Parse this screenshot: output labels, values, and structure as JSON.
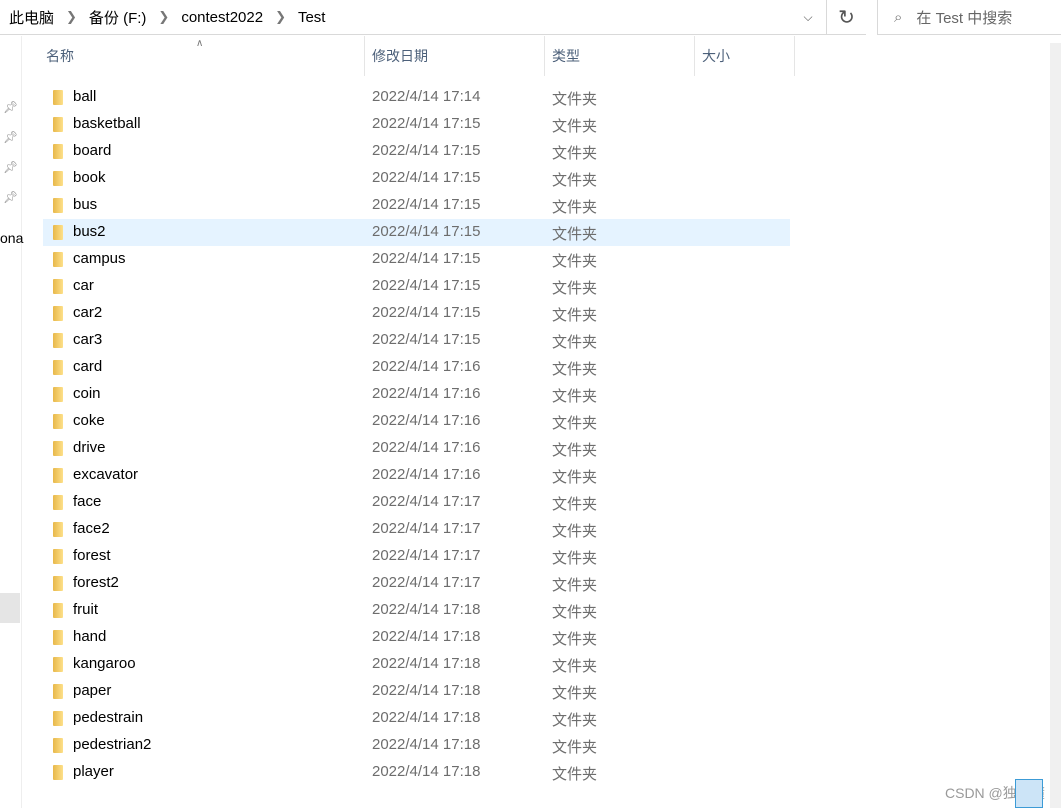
{
  "breadcrumb": [
    "此电脑",
    "备份 (F:)",
    "contest2022",
    "Test"
  ],
  "search": {
    "placeholder": "在 Test 中搜索"
  },
  "nav": {
    "partial_label": "ona"
  },
  "columns": {
    "name": "名称",
    "date": "修改日期",
    "type": "类型",
    "size": "大小"
  },
  "files": [
    {
      "name": "ball",
      "date": "2022/4/14 17:14",
      "type": "文件夹"
    },
    {
      "name": "basketball",
      "date": "2022/4/14 17:15",
      "type": "文件夹"
    },
    {
      "name": "board",
      "date": "2022/4/14 17:15",
      "type": "文件夹"
    },
    {
      "name": "book",
      "date": "2022/4/14 17:15",
      "type": "文件夹"
    },
    {
      "name": "bus",
      "date": "2022/4/14 17:15",
      "type": "文件夹"
    },
    {
      "name": "bus2",
      "date": "2022/4/14 17:15",
      "type": "文件夹",
      "hovered": true
    },
    {
      "name": "campus",
      "date": "2022/4/14 17:15",
      "type": "文件夹"
    },
    {
      "name": "car",
      "date": "2022/4/14 17:15",
      "type": "文件夹"
    },
    {
      "name": "car2",
      "date": "2022/4/14 17:15",
      "type": "文件夹"
    },
    {
      "name": "car3",
      "date": "2022/4/14 17:15",
      "type": "文件夹"
    },
    {
      "name": "card",
      "date": "2022/4/14 17:16",
      "type": "文件夹"
    },
    {
      "name": "coin",
      "date": "2022/4/14 17:16",
      "type": "文件夹"
    },
    {
      "name": "coke",
      "date": "2022/4/14 17:16",
      "type": "文件夹"
    },
    {
      "name": "drive",
      "date": "2022/4/14 17:16",
      "type": "文件夹"
    },
    {
      "name": "excavator",
      "date": "2022/4/14 17:16",
      "type": "文件夹"
    },
    {
      "name": "face",
      "date": "2022/4/14 17:17",
      "type": "文件夹"
    },
    {
      "name": "face2",
      "date": "2022/4/14 17:17",
      "type": "文件夹"
    },
    {
      "name": "forest",
      "date": "2022/4/14 17:17",
      "type": "文件夹"
    },
    {
      "name": "forest2",
      "date": "2022/4/14 17:17",
      "type": "文件夹"
    },
    {
      "name": "fruit",
      "date": "2022/4/14 17:18",
      "type": "文件夹"
    },
    {
      "name": "hand",
      "date": "2022/4/14 17:18",
      "type": "文件夹"
    },
    {
      "name": "kangaroo",
      "date": "2022/4/14 17:18",
      "type": "文件夹"
    },
    {
      "name": "paper",
      "date": "2022/4/14 17:18",
      "type": "文件夹"
    },
    {
      "name": "pedestrain",
      "date": "2022/4/14 17:18",
      "type": "文件夹"
    },
    {
      "name": "pedestrian2",
      "date": "2022/4/14 17:18",
      "type": "文件夹"
    },
    {
      "name": "player",
      "date": "2022/4/14 17:18",
      "type": "文件夹"
    }
  ],
  "watermark": "CSDN @独不懂"
}
